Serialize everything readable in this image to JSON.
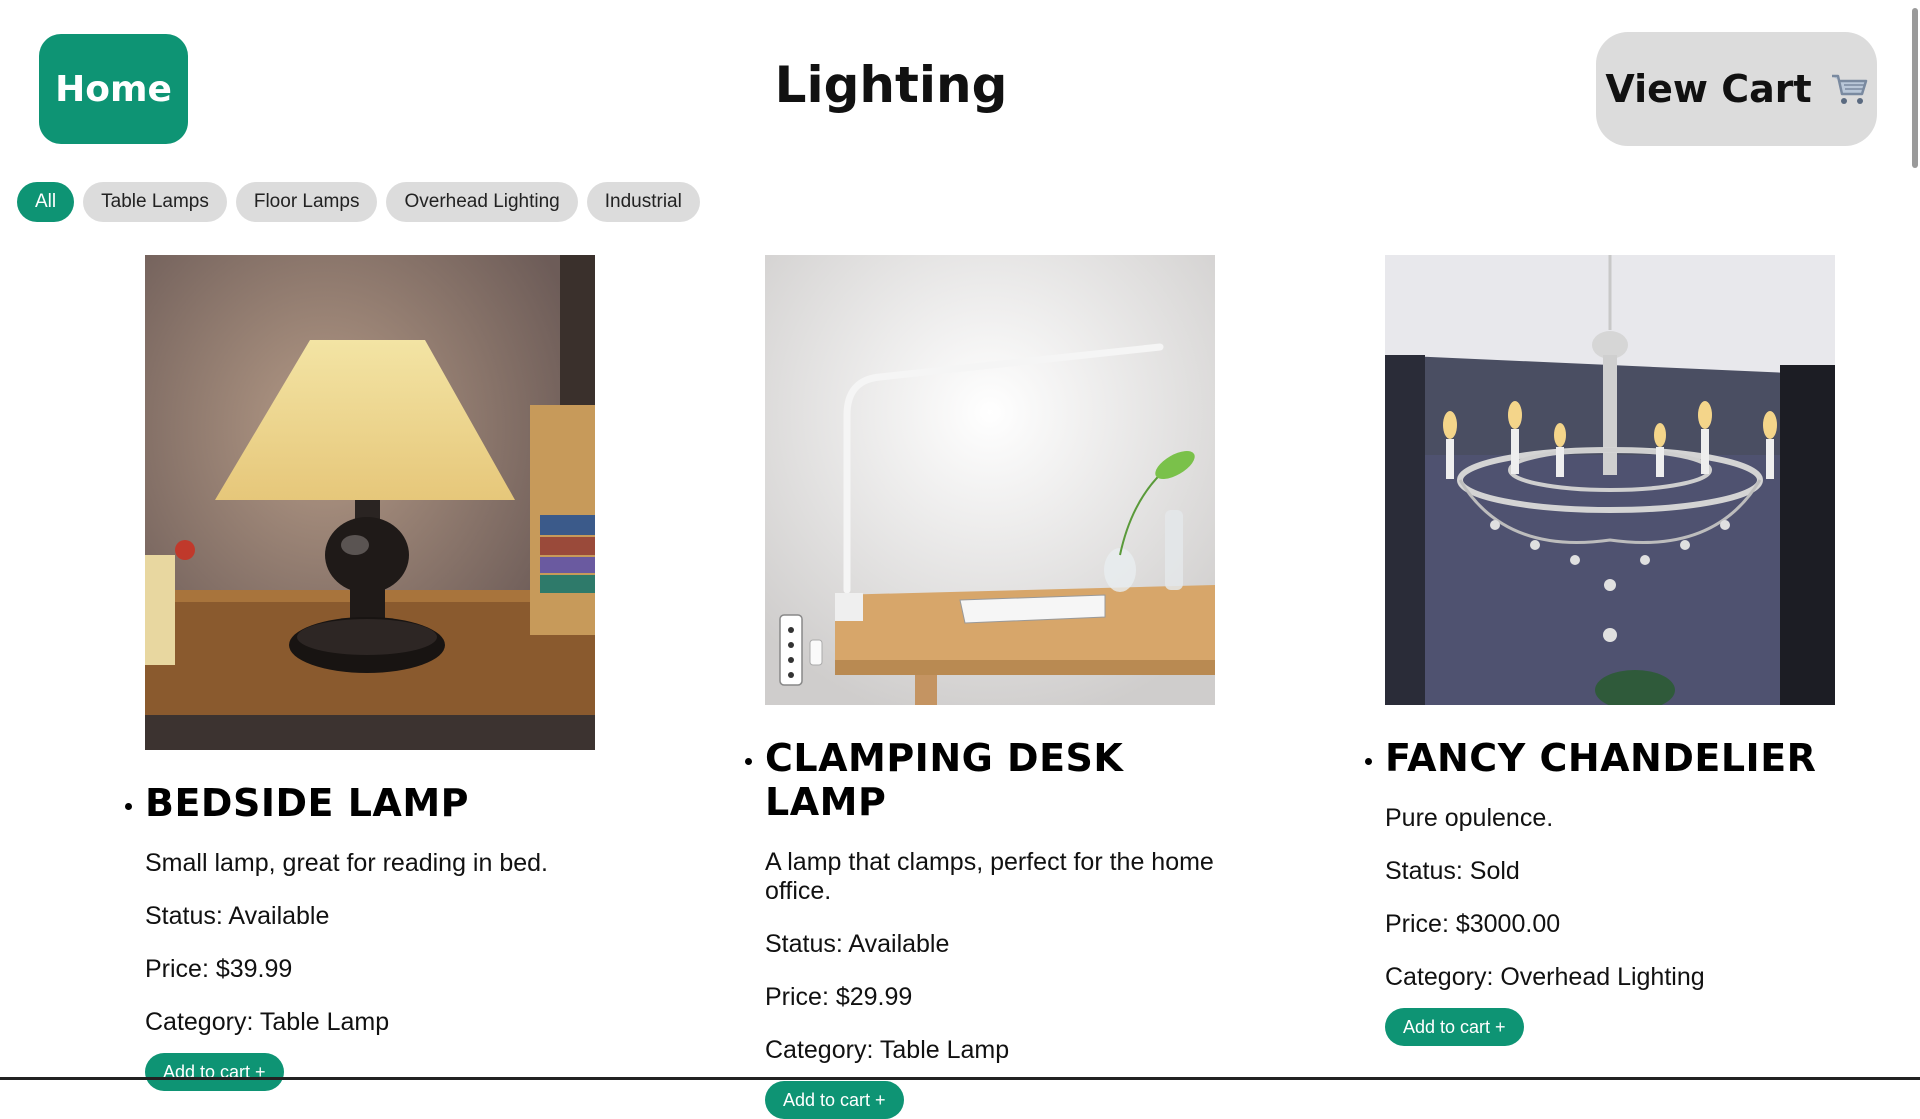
{
  "header": {
    "home_label": "Home",
    "title": "Lighting",
    "cart_label": "View Cart",
    "cart_icon": "cart-icon"
  },
  "filters": [
    {
      "label": "All",
      "active": true
    },
    {
      "label": "Table Lamps",
      "active": false
    },
    {
      "label": "Floor Lamps",
      "active": false
    },
    {
      "label": "Overhead Lighting",
      "active": false
    },
    {
      "label": "Industrial",
      "active": false
    }
  ],
  "products": [
    {
      "name": "Bedside Lamp",
      "description": "Small lamp, great for reading in bed.",
      "status": "Status: Available",
      "price": "Price: $39.99",
      "category": "Category: Table Lamp",
      "add_label": "Add to cart +"
    },
    {
      "name": "Clamping Desk Lamp",
      "description": "A lamp that clamps, perfect for the home office.",
      "status": "Status: Available",
      "price": "Price: $29.99",
      "category": "Category: Table Lamp",
      "add_label": "Add to cart +"
    },
    {
      "name": "Fancy Chandelier",
      "description": "Pure opulence.",
      "status": "Status: Sold",
      "price": "Price: $3000.00",
      "category": "Category: Overhead Lighting",
      "add_label": "Add to cart +"
    }
  ],
  "colors": {
    "accent": "#0e9474",
    "pill_bg": "#dcdcdc",
    "cart_bg": "#dcdcdc"
  }
}
